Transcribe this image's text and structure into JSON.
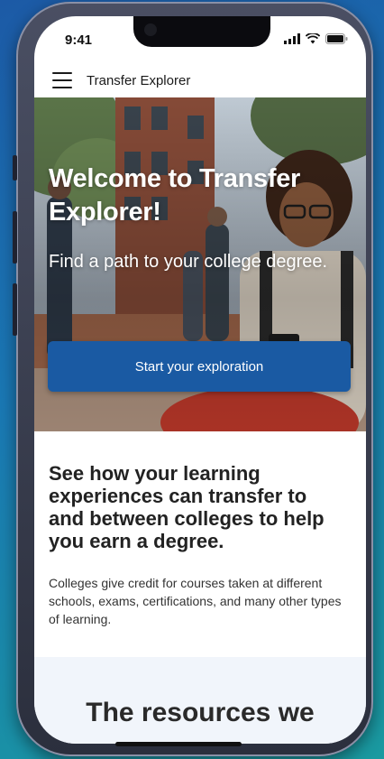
{
  "status": {
    "time": "9:41"
  },
  "appbar": {
    "title": "Transfer Explorer",
    "menu_icon": "hamburger-menu-icon"
  },
  "hero": {
    "title": "Welcome to Transfer Explorer!",
    "subtitle": "Find a path to your college degree.",
    "cta_label": "Start your exploration"
  },
  "intro": {
    "heading": "See how your learning experiences can transfer to and between colleges to help you earn a degree.",
    "body": "Colleges give credit for courses taken at different schools, exams, certifications, and many other types of learning."
  },
  "resources": {
    "heading": "The resources we"
  },
  "colors": {
    "primary": "#1a5aa3",
    "background_top": "#1c5aa6",
    "background_bottom": "#1a9aa0",
    "resources_bg": "#f1f5fb"
  }
}
